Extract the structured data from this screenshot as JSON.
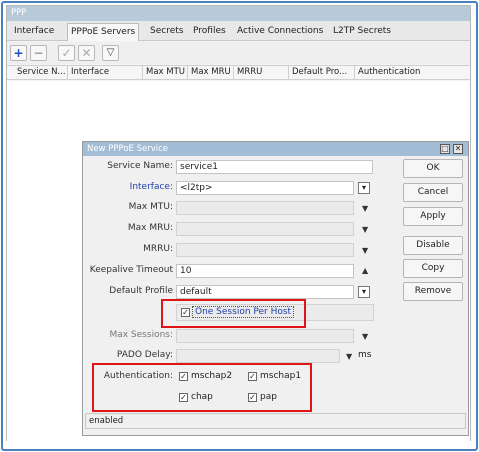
{
  "window": {
    "title": "PPP"
  },
  "tabs": [
    "Interface",
    "PPPoE Servers",
    "Secrets",
    "Profiles",
    "Active Connections",
    "L2TP Secrets"
  ],
  "columns": [
    "Service N...",
    "Interface",
    "Max MTU",
    "Max MRU",
    "MRRU",
    "Default Pro...",
    "Authentication"
  ],
  "dialog": {
    "title": "New PPPoE Service",
    "service_name_label": "Service Name:",
    "service_name_value": "service1",
    "interface_label": "Interface:",
    "interface_value": "<l2tp>",
    "max_mtu_label": "Max MTU:",
    "max_mru_label": "Max MRU:",
    "mrru_label": "MRRU:",
    "keepalive_label": "Keepalive Timeout",
    "keepalive_value": "10",
    "default_profile_label": "Default Profile",
    "default_profile_value": "default",
    "one_session_label": "One Session Per Host",
    "max_sessions_label": "Max Sessions:",
    "pado_delay_label": "PADO Delay:",
    "pado_unit": "ms",
    "auth_label": "Authentication:",
    "auth_options": [
      "mschap2",
      "mschap1",
      "chap",
      "pap"
    ],
    "status": "enabled",
    "buttons": [
      "OK",
      "Cancel",
      "Apply",
      "Disable",
      "Copy",
      "Remove"
    ]
  },
  "colors": {
    "highlight": "#e01616",
    "title_bar": "#a4bdd6",
    "frame": "#4a7fc0"
  }
}
